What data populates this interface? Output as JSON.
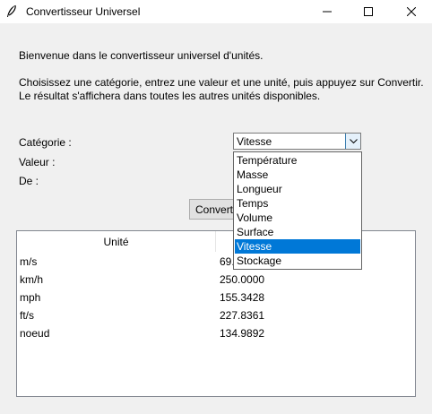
{
  "window": {
    "title": "Convertisseur Universel"
  },
  "intro": {
    "welcome": "Bienvenue dans le convertisseur universel d'unités.",
    "instruction_line1": "Choisissez une catégorie, entrez une valeur et une unité, puis appuyez sur Convertir.",
    "instruction_line2": "Le résultat s'affichera dans toutes les autres unités disponibles."
  },
  "form": {
    "category_label": "Catégorie :",
    "value_label": "Valeur :",
    "from_label": "De :",
    "category_selected": "Vitesse",
    "category_options": [
      "Température",
      "Masse",
      "Longueur",
      "Temps",
      "Volume",
      "Surface",
      "Vitesse",
      "Stockage"
    ],
    "convert_button": "Convertir"
  },
  "table": {
    "headers": [
      "Unité",
      ""
    ],
    "rows": [
      {
        "unit": "m/s",
        "value": "69.4"
      },
      {
        "unit": "km/h",
        "value": "250.0000"
      },
      {
        "unit": "mph",
        "value": "155.3428"
      },
      {
        "unit": "ft/s",
        "value": "227.8361"
      },
      {
        "unit": "noeud",
        "value": "134.9892"
      }
    ]
  },
  "colors": {
    "selection": "#0078d7",
    "window_bg": "#f0f0f0"
  }
}
